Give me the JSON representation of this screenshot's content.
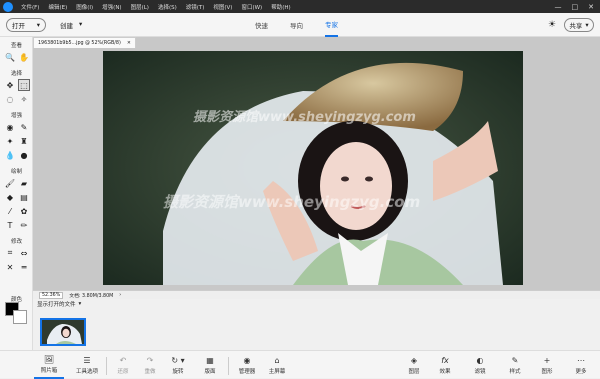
{
  "menu": {
    "items": [
      "文件(F)",
      "编辑(E)",
      "图像(I)",
      "增强(N)",
      "图层(L)",
      "选择(S)",
      "滤镜(T)",
      "视图(V)",
      "窗口(W)",
      "帮助(H)"
    ],
    "window_controls": [
      "—",
      "□",
      "✕"
    ]
  },
  "toolbar": {
    "open_label": "打开",
    "create_label": "创建",
    "modes": [
      "快速",
      "导向",
      "专家"
    ],
    "active_mode": "专家",
    "share_label": "共享"
  },
  "tools": {
    "sections": [
      "查看",
      "选择",
      "增强",
      "绘制",
      "修改",
      "颜色"
    ]
  },
  "document": {
    "tab_title": "1963801b9b5...jpg @ 52%(RGB/8)"
  },
  "status": {
    "zoom": "52.36%",
    "doc_info": "文档: 3.80M/3.80M"
  },
  "photo_bin": {
    "label": "显示打开的文件"
  },
  "bottom": {
    "left_items": [
      {
        "label": "照片箱",
        "icon": "photo-bin-icon",
        "glyph": "🖼"
      },
      {
        "label": "工具选项",
        "icon": "tool-options-icon",
        "glyph": "☰"
      },
      {
        "label": "还原",
        "icon": "undo-icon",
        "glyph": "↶"
      },
      {
        "label": "重做",
        "icon": "redo-icon",
        "glyph": "↷"
      },
      {
        "label": "旋转",
        "icon": "rotate-icon",
        "glyph": "↻"
      },
      {
        "label": "版面",
        "icon": "layout-icon",
        "glyph": "▦"
      },
      {
        "label": "管理器",
        "icon": "organizer-icon",
        "glyph": "◉"
      },
      {
        "label": "主屏幕",
        "icon": "home-icon",
        "glyph": "⌂"
      }
    ],
    "right_items": [
      {
        "label": "图层",
        "icon": "layers-icon",
        "glyph": "◈"
      },
      {
        "label": "效果",
        "icon": "effects-icon",
        "glyph": "fx"
      },
      {
        "label": "滤镜",
        "icon": "filters-icon",
        "glyph": "◐"
      },
      {
        "label": "样式",
        "icon": "styles-icon",
        "glyph": "✎"
      },
      {
        "label": "图形",
        "icon": "graphics-icon",
        "glyph": "+"
      },
      {
        "label": "更多",
        "icon": "more-icon",
        "glyph": "⋯"
      }
    ]
  },
  "watermarks": [
    "摄影资源馆www.sheyingzyg.com",
    "摄影资源馆www.sheyingzyg.com"
  ],
  "colors": {
    "accent": "#1473e6",
    "menubar": "#2b2b2b"
  }
}
